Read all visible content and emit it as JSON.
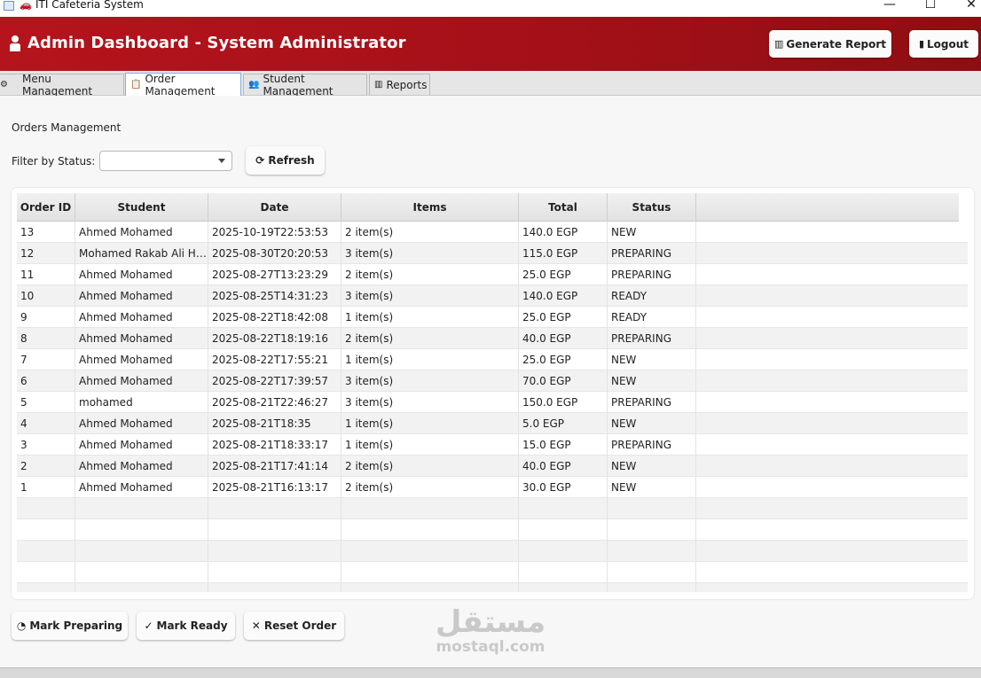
{
  "window": {
    "title": "ITI Cafeteria System",
    "minimize": "—",
    "maximize": "☐",
    "close": "✕"
  },
  "header": {
    "title": "Admin Dashboard - System Administrator",
    "generate_report": "Generate Report",
    "logout": "Logout",
    "accent": "#a51018"
  },
  "tabs": [
    {
      "label": "Menu Management",
      "icon": "gear-icon"
    },
    {
      "label": "Order Management",
      "icon": "clipboard-icon",
      "active": true
    },
    {
      "label": "Student Management",
      "icon": "users-icon"
    },
    {
      "label": "Reports",
      "icon": "chart-icon"
    }
  ],
  "orders": {
    "section_title": "Orders Management",
    "filter_label": "Filter by Status:",
    "filter_value": "",
    "refresh_label": "Refresh",
    "columns": [
      "Order ID",
      "Student",
      "Date",
      "Items",
      "Total",
      "Status"
    ],
    "rows": [
      [
        "13",
        "Ahmed Mohamed",
        "2025-10-19T22:53:53",
        "2 item(s)",
        "140.0 EGP",
        "NEW"
      ],
      [
        "12",
        "Mohamed Rakab Ali Hu...",
        "2025-08-30T20:20:53",
        "3 item(s)",
        "115.0 EGP",
        "PREPARING"
      ],
      [
        "11",
        "Ahmed Mohamed",
        "2025-08-27T13:23:29",
        "2 item(s)",
        "25.0 EGP",
        "PREPARING"
      ],
      [
        "10",
        "Ahmed Mohamed",
        "2025-08-25T14:31:23",
        "3 item(s)",
        "140.0 EGP",
        "READY"
      ],
      [
        "9",
        "Ahmed Mohamed",
        "2025-08-22T18:42:08",
        "1 item(s)",
        "25.0 EGP",
        "READY"
      ],
      [
        "8",
        "Ahmed Mohamed",
        "2025-08-22T18:19:16",
        "2 item(s)",
        "40.0 EGP",
        "PREPARING"
      ],
      [
        "7",
        "Ahmed Mohamed",
        "2025-08-22T17:55:21",
        "1 item(s)",
        "25.0 EGP",
        "NEW"
      ],
      [
        "6",
        "Ahmed Mohamed",
        "2025-08-22T17:39:57",
        "3 item(s)",
        "70.0 EGP",
        "NEW"
      ],
      [
        "5",
        "mohamed",
        "2025-08-21T22:46:27",
        "3 item(s)",
        "150.0 EGP",
        "PREPARING"
      ],
      [
        "4",
        "Ahmed Mohamed",
        "2025-08-21T18:35",
        "1 item(s)",
        "5.0 EGP",
        "NEW"
      ],
      [
        "3",
        "Ahmed Mohamed",
        "2025-08-21T18:33:17",
        "1 item(s)",
        "15.0 EGP",
        "PREPARING"
      ],
      [
        "2",
        "Ahmed Mohamed",
        "2025-08-21T17:41:14",
        "2 item(s)",
        "40.0 EGP",
        "NEW"
      ],
      [
        "1",
        "Ahmed Mohamed",
        "2025-08-21T16:13:17",
        "2 item(s)",
        "30.0 EGP",
        "NEW"
      ]
    ]
  },
  "actions": {
    "mark_preparing": "Mark Preparing",
    "mark_ready": "Mark Ready",
    "reset_order": "Reset Order"
  },
  "watermark": {
    "arabic": "مستقل",
    "latin": "mostaql.com"
  }
}
